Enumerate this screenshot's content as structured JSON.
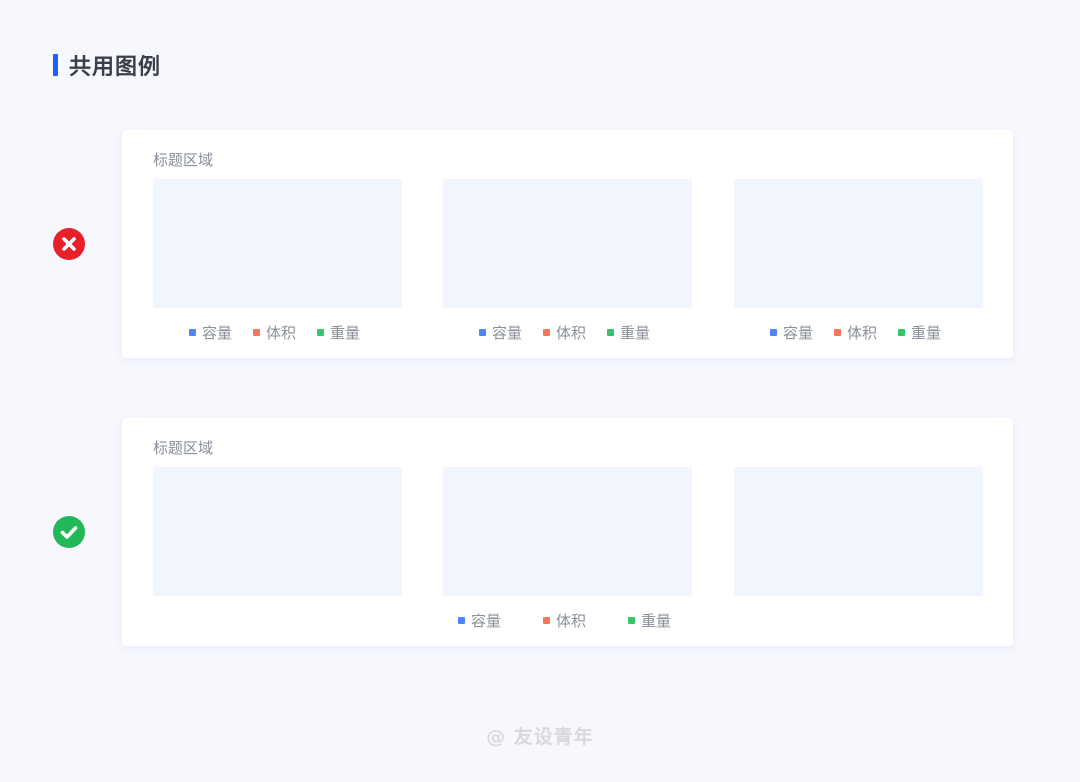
{
  "heading": "共用图例",
  "colors": {
    "accent": "#1a62f5",
    "wrong": "#e8202a",
    "right": "#22b857",
    "series_1": "#4f86f7",
    "series_2": "#f4775a",
    "series_3": "#36c46e"
  },
  "icons": {
    "wrong": "cross-circle-icon",
    "right": "check-circle-icon"
  },
  "legend_items": [
    "容量",
    "体积",
    "重量"
  ],
  "wrong_example": {
    "title": "标题区域",
    "legends": [
      [
        "容量",
        "体积",
        "重量"
      ],
      [
        "容量",
        "体积",
        "重量"
      ],
      [
        "容量",
        "体积",
        "重量"
      ]
    ]
  },
  "right_example": {
    "title": "标题区域",
    "legend": [
      "容量",
      "体积",
      "重量"
    ]
  },
  "watermark": "@ 友设青年"
}
